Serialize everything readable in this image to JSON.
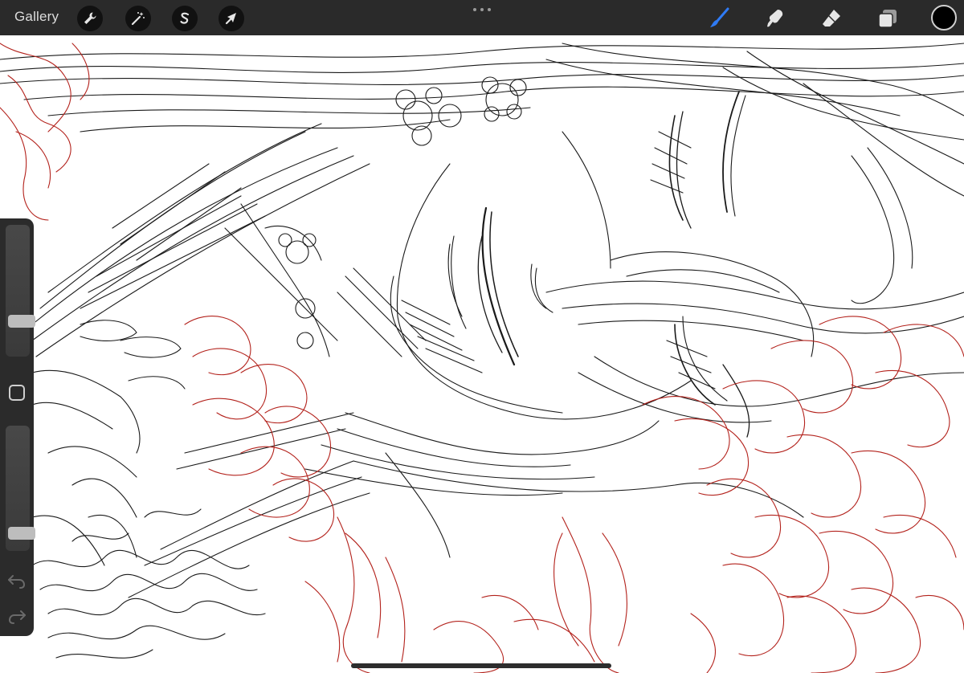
{
  "toolbar": {
    "gallery_label": "Gallery",
    "left_tools": [
      {
        "id": "actions",
        "icon": "wrench-icon"
      },
      {
        "id": "adjustments",
        "icon": "magic-wand-icon"
      },
      {
        "id": "selection",
        "icon": "selection-s-icon"
      },
      {
        "id": "transform",
        "icon": "arrow-cursor-icon"
      }
    ],
    "right_tools": [
      {
        "id": "brush",
        "icon": "brush-icon",
        "active": true
      },
      {
        "id": "smudge",
        "icon": "smudge-finger-icon"
      },
      {
        "id": "eraser",
        "icon": "eraser-icon"
      },
      {
        "id": "layers",
        "icon": "layers-icon"
      }
    ],
    "current_color": "#000000"
  },
  "sidebar": {
    "brush_size_level": 0.76,
    "brush_opacity_level": 0.9,
    "controls": [
      "modify-square-icon",
      "undo-icon",
      "redo-icon"
    ]
  },
  "colors": {
    "toolbar_bg": "#2a2a2a",
    "active_tool": "#2f7bf5",
    "ink_black": "#1a1a1a",
    "ink_red": "#b3221c"
  }
}
